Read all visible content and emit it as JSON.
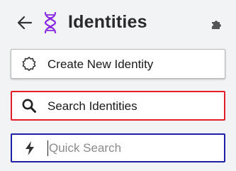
{
  "header": {
    "title": "Identities",
    "back_icon": "arrow-left-icon",
    "logo_icon": "dna-icon",
    "logo_color": "#8a2be2",
    "extension_icon": "puzzle-icon"
  },
  "actions": {
    "create": {
      "label": "Create New Identity",
      "icon": "cog-outline-icon"
    },
    "search": {
      "label": "Search Identities",
      "icon": "search-icon",
      "border_color": "#e3202a"
    },
    "quick_search": {
      "placeholder": "Quick Search",
      "value": "",
      "icon": "lightning-icon",
      "border_color": "#1f1fa8"
    }
  }
}
